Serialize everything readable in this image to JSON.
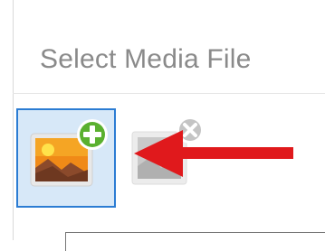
{
  "dialog": {
    "title": "Select Media File"
  },
  "toolbar": {
    "add_media": {
      "icon": "image-add-icon",
      "state": "selected"
    },
    "remove_media": {
      "icon": "image-remove-icon",
      "state": "disabled"
    }
  },
  "annotation": {
    "icon": "red-arrow-icon",
    "color": "#e0191c"
  },
  "colors": {
    "selection_border": "#2b7cd3",
    "selection_fill": "#d7e8f8",
    "title_text": "#8a8a8a",
    "add_badge": "#5ab02f"
  }
}
